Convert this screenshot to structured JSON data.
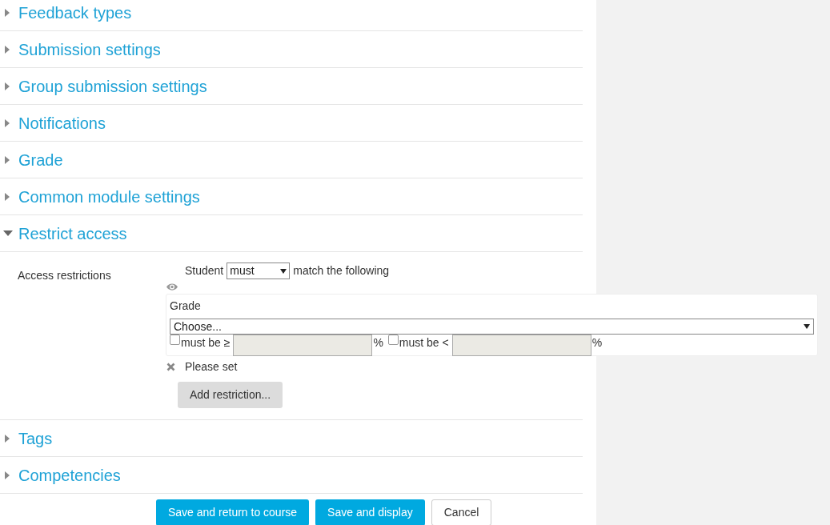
{
  "sections_before": [
    {
      "title": "Feedback types",
      "expanded": false
    },
    {
      "title": "Submission settings",
      "expanded": false
    },
    {
      "title": "Group submission settings",
      "expanded": false
    },
    {
      "title": "Notifications",
      "expanded": false
    },
    {
      "title": "Grade",
      "expanded": false
    },
    {
      "title": "Common module settings",
      "expanded": false
    },
    {
      "title": "Restrict access",
      "expanded": true
    }
  ],
  "restrict": {
    "label": "Access restrictions",
    "student": "Student",
    "match_value": "must",
    "match_suffix": "match the following",
    "condition": {
      "title": "Grade",
      "select_value": "Choose...",
      "min_label": "must be ≥",
      "min_checked": false,
      "min_unit": "%",
      "max_label": "must be <",
      "max_checked": false,
      "max_unit": "%"
    },
    "error": "Please set",
    "add_button": "Add restriction..."
  },
  "sections_after": [
    {
      "title": "Tags",
      "expanded": false
    },
    {
      "title": "Competencies",
      "expanded": false
    }
  ],
  "buttons": [
    {
      "label": "Save and return to course",
      "kind": "primary"
    },
    {
      "label": "Save and display",
      "kind": "primary"
    },
    {
      "label": "Cancel",
      "kind": "secondary"
    }
  ]
}
